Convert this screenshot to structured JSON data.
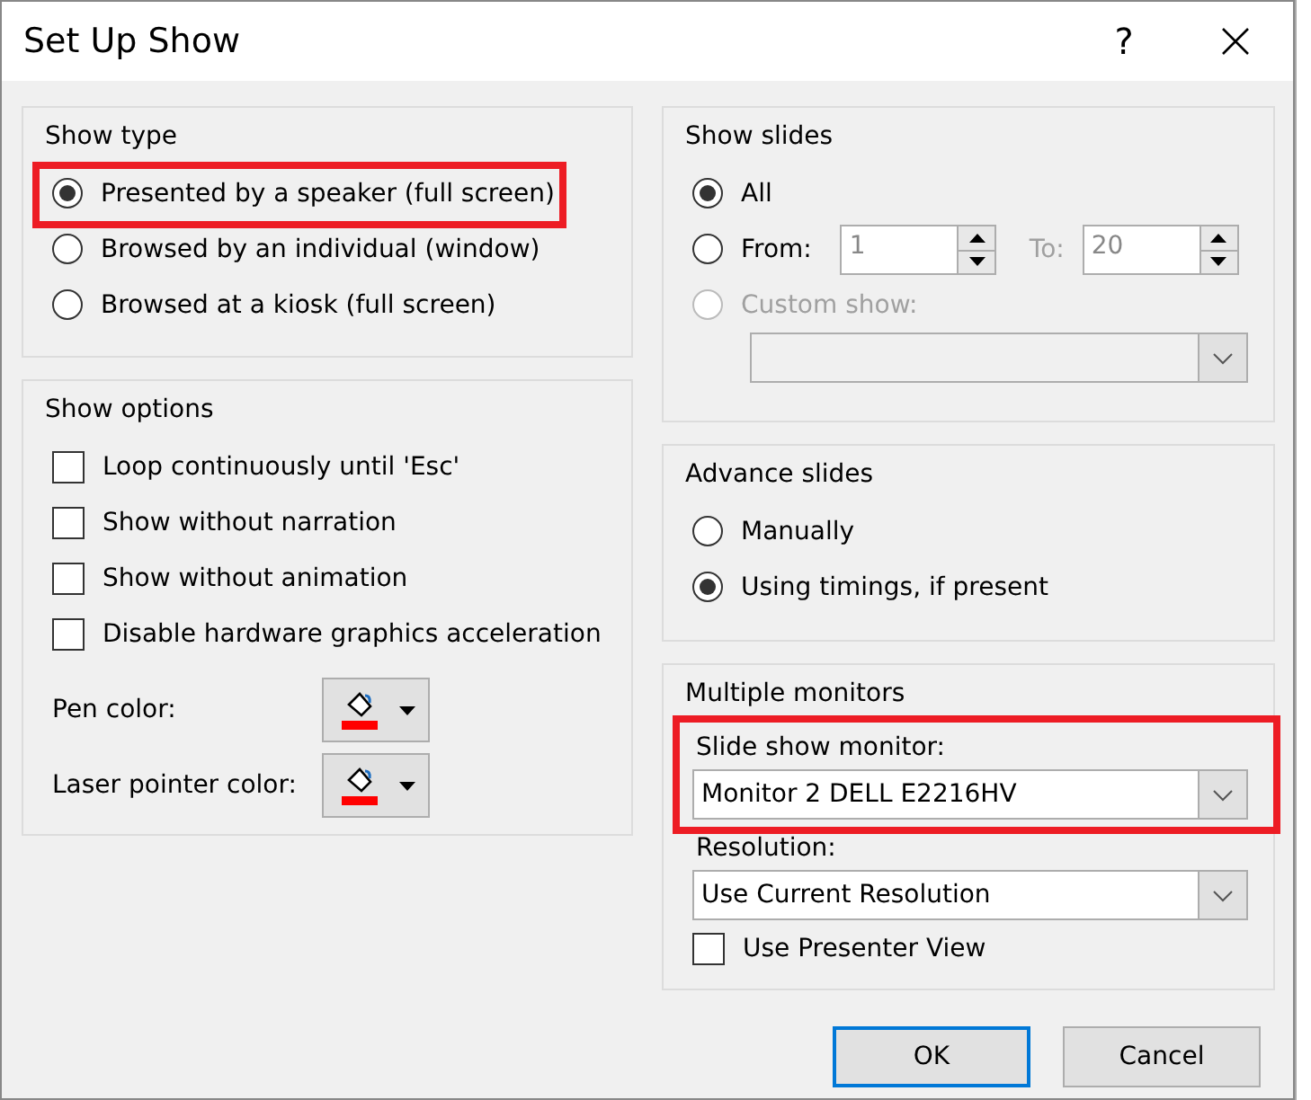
{
  "window": {
    "title": "Set Up Show",
    "help": "?"
  },
  "show_type": {
    "title": "Show type",
    "options": [
      {
        "label": "Presented by a speaker (full screen)",
        "selected": true,
        "highlighted": true
      },
      {
        "label": "Browsed by an individual (window)",
        "selected": false,
        "highlighted": false
      },
      {
        "label": "Browsed at a kiosk (full screen)",
        "selected": false,
        "highlighted": false
      }
    ]
  },
  "show_options": {
    "title": "Show options",
    "checkboxes": [
      {
        "label": "Loop continuously until 'Esc'",
        "checked": false
      },
      {
        "label": "Show without narration",
        "checked": false
      },
      {
        "label": "Show without animation",
        "checked": false
      },
      {
        "label": "Disable hardware graphics acceleration",
        "checked": false
      }
    ],
    "colors": [
      {
        "label": "Pen color:",
        "color": "#ff0000"
      },
      {
        "label": "Laser pointer color:",
        "color": "#ff0000"
      }
    ]
  },
  "show_slides": {
    "title": "Show slides",
    "options": [
      {
        "kind": "all",
        "label": "All",
        "selected": true,
        "disabled": false
      },
      {
        "kind": "range",
        "label": "From:",
        "selected": false,
        "disabled": false,
        "from": "1",
        "to_label": "To:",
        "to": "20"
      },
      {
        "kind": "custom",
        "label": "Custom show:",
        "selected": false,
        "disabled": true
      }
    ]
  },
  "advance_slides": {
    "title": "Advance slides",
    "options": [
      {
        "label": "Manually",
        "selected": false
      },
      {
        "label": "Using timings, if present",
        "selected": true
      }
    ]
  },
  "multiple_monitors": {
    "title": "Multiple monitors",
    "monitor": {
      "label": "Slide show monitor:",
      "value": "Monitor 2 DELL E2216HV",
      "highlighted": true
    },
    "resolution": {
      "label": "Resolution:",
      "value": "Use Current Resolution"
    },
    "presenter_view": {
      "label": "Use Presenter View",
      "checked": false
    }
  },
  "buttons": [
    {
      "label": "OK",
      "default": true
    },
    {
      "label": "Cancel",
      "default": false
    }
  ]
}
